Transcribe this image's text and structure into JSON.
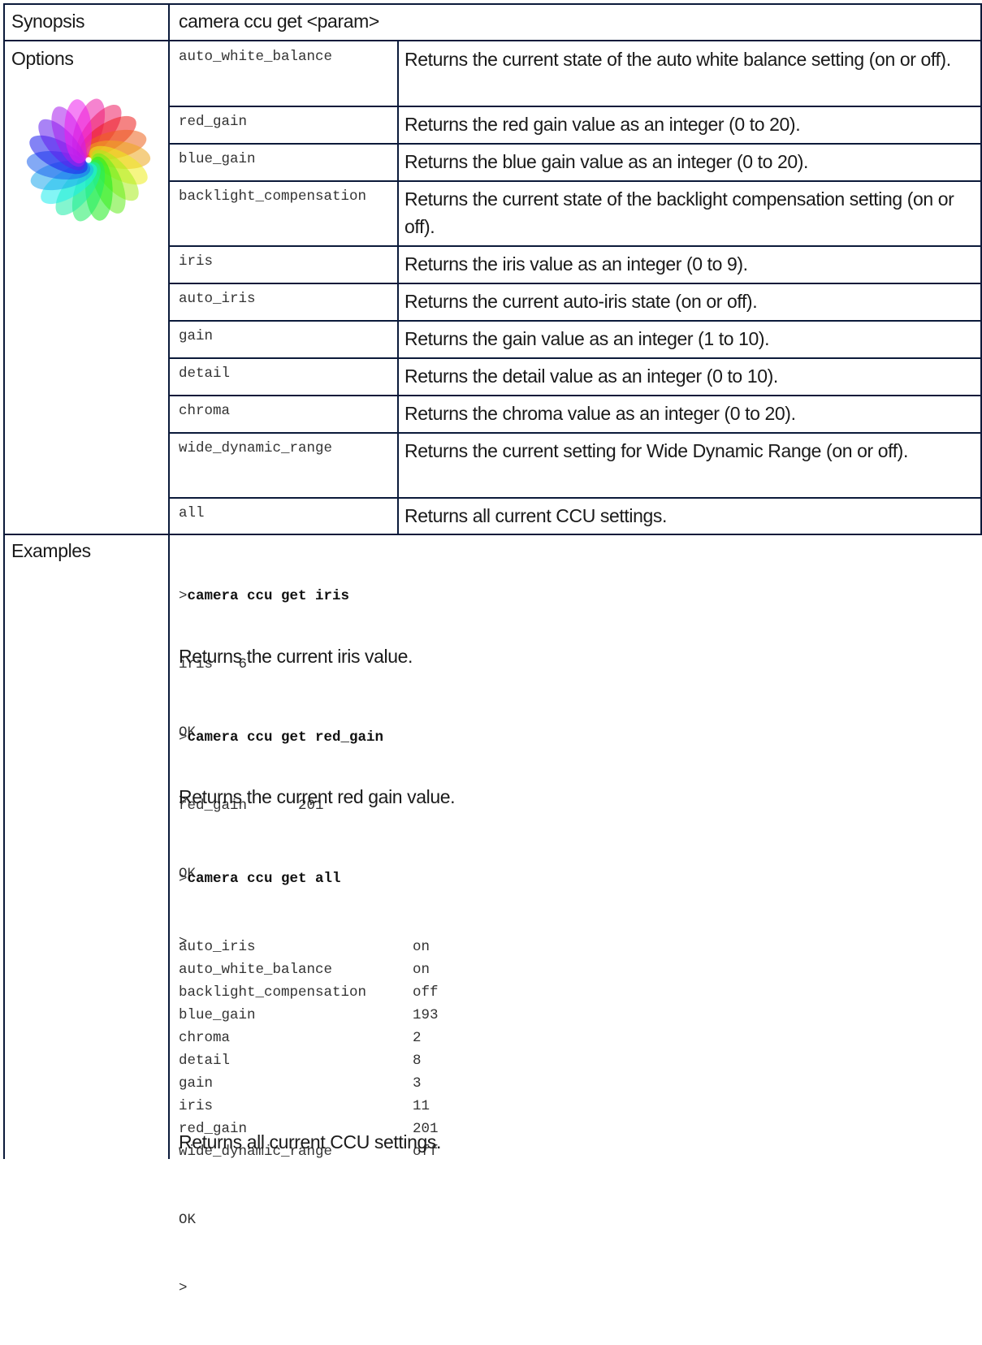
{
  "synopsis": {
    "label": "Synopsis",
    "text": "camera ccu get <param>"
  },
  "options": {
    "label": "Options",
    "icon": "color-wheel-icon",
    "rows": [
      {
        "name": "auto_white_balance",
        "desc": "Returns the current state of the auto white balance setting (on or off)."
      },
      {
        "name": "red_gain",
        "desc": "Returns the red gain value as an integer (0 to 20)."
      },
      {
        "name": "blue_gain",
        "desc": "Returns the blue gain value as an integer (0 to 20)."
      },
      {
        "name": "backlight_compensation",
        "desc": "Returns the current state of the backlight compensation setting (on or off)."
      },
      {
        "name": "iris",
        "desc": "Returns the iris value as an integer (0 to 9)."
      },
      {
        "name": "auto_iris",
        "desc": "Returns the current auto-iris state (on or off)."
      },
      {
        "name": "gain",
        "desc": "Returns the gain value as an integer (1 to 10)."
      },
      {
        "name": "detail",
        "desc": "Returns the detail value as an integer (0 to 10)."
      },
      {
        "name": "chroma",
        "desc": "Returns the chroma value as an integer (0 to 20)."
      },
      {
        "name": "wide_dynamic_range",
        "desc": "Returns the current setting for Wide Dynamic Range (on or off)."
      },
      {
        "name": "all",
        "desc": "Returns all current CCU settings."
      }
    ]
  },
  "examples": {
    "label": "Examples",
    "prompt": ">",
    "ex1": {
      "command": "camera ccu get iris",
      "output_key": "iris",
      "output_val": "6",
      "ok": "OK",
      "end_prompt": ">",
      "caption": "Returns the current iris value."
    },
    "ex2": {
      "command": "camera ccu get red_gain",
      "output_key": "red_gain",
      "output_val": "201",
      "ok": "OK",
      "end_prompt": ">",
      "caption": "Returns the current red gain value."
    },
    "ex3": {
      "command": "camera ccu get all",
      "rows": [
        {
          "k": "auto_iris",
          "v": "on"
        },
        {
          "k": "auto_white_balance",
          "v": "on"
        },
        {
          "k": "backlight_compensation",
          "v": "off"
        },
        {
          "k": "blue_gain",
          "v": "193"
        },
        {
          "k": "chroma",
          "v": "2"
        },
        {
          "k": "detail",
          "v": "8"
        },
        {
          "k": "gain",
          "v": "3"
        },
        {
          "k": "iris",
          "v": "11"
        },
        {
          "k": "red_gain",
          "v": "201"
        },
        {
          "k": "wide_dynamic_range",
          "v": "off"
        }
      ],
      "ok": "OK",
      "end_prompt": ">",
      "caption": "Returns all current CCU settings."
    }
  }
}
